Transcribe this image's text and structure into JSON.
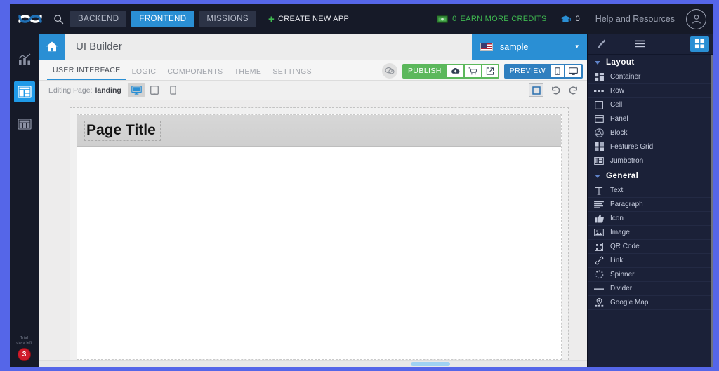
{
  "topbar": {
    "logo_icon": "infinity-logo-icon",
    "search_icon": "search-icon",
    "nav": [
      {
        "label": "BACKEND",
        "active": false
      },
      {
        "label": "FRONTEND",
        "active": true
      },
      {
        "label": "MISSIONS",
        "active": false
      }
    ],
    "create_app": {
      "label": "CREATE NEW APP",
      "plus": "+",
      "icon": "plus-icon"
    },
    "credits": {
      "icon": "money-icon",
      "count": "0",
      "label": "EARN MORE CREDITS"
    },
    "graduation": {
      "icon": "graduation-cap-icon",
      "count": "0"
    },
    "help": "Help and Resources",
    "avatar_icon": "user-avatar-icon"
  },
  "rail": {
    "items": [
      {
        "name": "analytics-icon",
        "active": false
      },
      {
        "name": "ui-builder-icon",
        "active": true
      },
      {
        "name": "database-icon",
        "active": false
      }
    ],
    "trial": {
      "line1": "Trial",
      "line2": "days left",
      "days": "3"
    }
  },
  "appheader": {
    "home_icon": "home-icon",
    "title": "UI Builder",
    "language": {
      "flag": "us-flag-icon",
      "label": "sample",
      "caret": "▾"
    }
  },
  "tabs": [
    {
      "label": "USER INTERFACE",
      "active": true
    },
    {
      "label": "LOGIC",
      "active": false
    },
    {
      "label": "COMPONENTS",
      "active": false
    },
    {
      "label": "THEME",
      "active": false
    },
    {
      "label": "SETTINGS",
      "active": false
    }
  ],
  "actions": {
    "chat_icon": "chat-bubbles-icon",
    "publish": {
      "label": "PUBLISH",
      "icons": [
        "cloud-upload-icon",
        "cart-icon",
        "external-link-icon"
      ]
    },
    "preview": {
      "label": "PREVIEW",
      "icons": [
        "mobile-icon",
        "desktop-icon"
      ]
    }
  },
  "editbar": {
    "label": "Editing Page:",
    "page": "landing",
    "devices": [
      {
        "name": "desktop-icon",
        "active": true
      },
      {
        "name": "tablet-icon",
        "active": false
      },
      {
        "name": "mobile-icon",
        "active": false
      }
    ],
    "select_icon": "select-frame-icon",
    "undo_icon": "undo-icon",
    "redo_icon": "redo-icon"
  },
  "canvas": {
    "page_title": "Page Title"
  },
  "rightpanel": {
    "header_icons": [
      {
        "name": "paintbrush-icon",
        "active": false
      },
      {
        "name": "list-icon",
        "active": false
      },
      {
        "name": "grid-icon",
        "active": true
      }
    ],
    "sections": [
      {
        "title": "Layout",
        "items": [
          {
            "label": "Container",
            "icon": "container-icon"
          },
          {
            "label": "Row",
            "icon": "row-icon"
          },
          {
            "label": "Cell",
            "icon": "cell-icon"
          },
          {
            "label": "Panel",
            "icon": "panel-icon"
          },
          {
            "label": "Block",
            "icon": "block-icon"
          },
          {
            "label": "Features Grid",
            "icon": "features-grid-icon"
          },
          {
            "label": "Jumbotron",
            "icon": "jumbotron-icon"
          }
        ]
      },
      {
        "title": "General",
        "items": [
          {
            "label": "Text",
            "icon": "text-icon"
          },
          {
            "label": "Paragraph",
            "icon": "paragraph-icon"
          },
          {
            "label": "Icon",
            "icon": "thumbs-up-icon"
          },
          {
            "label": "Image",
            "icon": "image-icon"
          },
          {
            "label": "QR Code",
            "icon": "qr-code-icon"
          },
          {
            "label": "Link",
            "icon": "link-icon"
          },
          {
            "label": "Spinner",
            "icon": "spinner-icon"
          },
          {
            "label": "Divider",
            "icon": "divider-icon"
          },
          {
            "label": "Google Map",
            "icon": "google-map-icon"
          }
        ]
      }
    ]
  },
  "colors": {
    "page_background": "#5566e8",
    "topbar": "#161a28",
    "accent_blue": "#2a8fd4",
    "publish_green": "#5cb85c",
    "panel_dark": "#1b2138",
    "trial_red": "#cf1b2b"
  }
}
